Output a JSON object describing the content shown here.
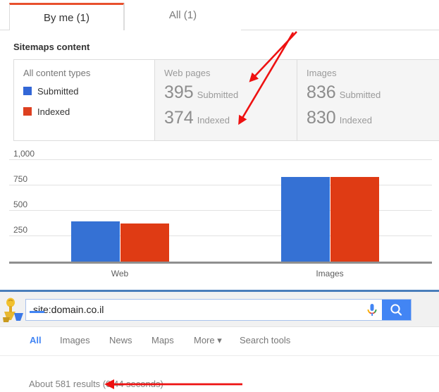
{
  "search_console": {
    "tabs": [
      {
        "label": "By me (1)",
        "active": true
      },
      {
        "label": "All (1)",
        "active": false
      }
    ],
    "section_title": "Sitemaps content",
    "content_types_panel": {
      "title": "All content types",
      "legend": [
        {
          "label": "Submitted",
          "color": "#3367d6"
        },
        {
          "label": "Indexed",
          "color": "#dd4020"
        }
      ]
    },
    "stat_panels": [
      {
        "title": "Web pages",
        "rows": [
          {
            "value": "395",
            "label": "Submitted"
          },
          {
            "value": "374",
            "label": "Indexed"
          }
        ]
      },
      {
        "title": "Images",
        "rows": [
          {
            "value": "836",
            "label": "Submitted"
          },
          {
            "value": "830",
            "label": "Indexed"
          }
        ]
      }
    ]
  },
  "chart_data": {
    "type": "bar",
    "title": "Sitemaps content",
    "categories": [
      "Web",
      "Images"
    ],
    "series": [
      {
        "name": "Submitted",
        "values": [
          395,
          836
        ],
        "color": "#3571d4"
      },
      {
        "name": "Indexed",
        "values": [
          374,
          830
        ],
        "color": "#df3b14"
      }
    ],
    "xlabel": "",
    "ylabel": "",
    "ylim": [
      0,
      1000
    ],
    "yticks": [
      250,
      500,
      750,
      1000
    ],
    "ytick_labels": [
      "250",
      "500",
      "750",
      "1,000"
    ],
    "grid": true,
    "legend_position": "left-panel"
  },
  "serp": {
    "search": {
      "value": "site:domain.co.il",
      "placeholder": "Search"
    },
    "nav_items": [
      {
        "label": "All",
        "selected": true
      },
      {
        "label": "Images",
        "selected": false
      },
      {
        "label": "News",
        "selected": false
      },
      {
        "label": "Maps",
        "selected": false
      },
      {
        "label": "More",
        "selected": false,
        "caret": true
      },
      {
        "label": "Search tools",
        "selected": false
      }
    ],
    "result_count": "About 581 results (0.44 seconds)"
  },
  "annotations": {
    "arrow_color": "#ee1111",
    "count": 3
  }
}
